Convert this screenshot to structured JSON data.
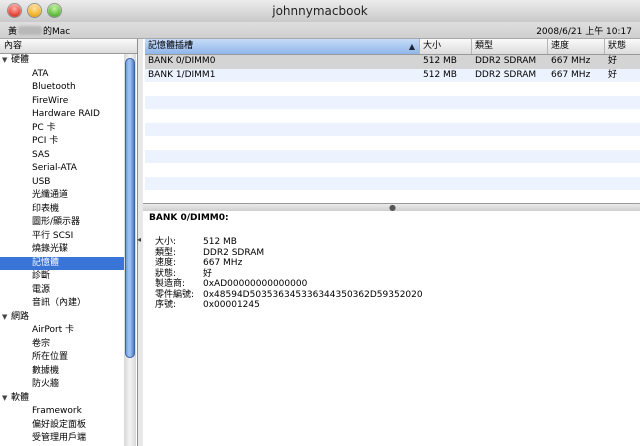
{
  "window": {
    "title": "johnnymacbook",
    "machine_name_prefix": "黃",
    "machine_name_suffix": "的Mac",
    "datetime": "2008/6/21 上午 10:17"
  },
  "sidebar": {
    "header": "內容",
    "tree": [
      {
        "type": "category",
        "label": "硬體",
        "expanded": true
      },
      {
        "type": "item",
        "label": "ATA"
      },
      {
        "type": "item",
        "label": "Bluetooth"
      },
      {
        "type": "item",
        "label": "FireWire"
      },
      {
        "type": "item",
        "label": "Hardware RAID"
      },
      {
        "type": "item",
        "label": "PC 卡"
      },
      {
        "type": "item",
        "label": "PCI 卡"
      },
      {
        "type": "item",
        "label": "SAS"
      },
      {
        "type": "item",
        "label": "Serial-ATA"
      },
      {
        "type": "item",
        "label": "USB"
      },
      {
        "type": "item",
        "label": "光纖通道"
      },
      {
        "type": "item",
        "label": "印表機"
      },
      {
        "type": "item",
        "label": "圖形/顯示器"
      },
      {
        "type": "item",
        "label": "平行 SCSI"
      },
      {
        "type": "item",
        "label": "燒錄光碟"
      },
      {
        "type": "item",
        "label": "記憶體",
        "selected": true
      },
      {
        "type": "item",
        "label": "診斷"
      },
      {
        "type": "item",
        "label": "電源"
      },
      {
        "type": "item",
        "label": "音訊（內建）"
      },
      {
        "type": "category",
        "label": "網路",
        "expanded": true
      },
      {
        "type": "item",
        "label": "AirPort 卡"
      },
      {
        "type": "item",
        "label": "卷宗"
      },
      {
        "type": "item",
        "label": "所在位置"
      },
      {
        "type": "item",
        "label": "數據機"
      },
      {
        "type": "item",
        "label": "防火牆"
      },
      {
        "type": "category",
        "label": "軟體",
        "expanded": true
      },
      {
        "type": "item",
        "label": "Framework"
      },
      {
        "type": "item",
        "label": "偏好設定面板"
      },
      {
        "type": "item",
        "label": "受管理用戶端"
      }
    ]
  },
  "table": {
    "columns": [
      "記憶體插槽",
      "大小",
      "類型",
      "速度",
      "狀態"
    ],
    "sort_indicator": "▲",
    "rows": [
      [
        "BANK 0/DIMM0",
        "512 MB",
        "DDR2 SDRAM",
        "667 MHz",
        "好"
      ],
      [
        "BANK 1/DIMM1",
        "512 MB",
        "DDR2 SDRAM",
        "667 MHz",
        "好"
      ]
    ],
    "selected_row": 0
  },
  "detail": {
    "title": "BANK 0/DIMM0:",
    "fields": [
      {
        "label": "大小:",
        "value": "512 MB"
      },
      {
        "label": "類型:",
        "value": "DDR2 SDRAM"
      },
      {
        "label": "速度:",
        "value": "667 MHz"
      },
      {
        "label": "狀態:",
        "value": "好"
      },
      {
        "label": "製造商:",
        "value": "0xAD00000000000000"
      },
      {
        "label": "零件編號:",
        "value": "0x48594D503536345336344350362D59352020"
      },
      {
        "label": "序號:",
        "value": "0x00001245"
      }
    ]
  },
  "icons": {
    "close": "close-icon",
    "minimize": "minimize-icon",
    "zoom": "zoom-icon",
    "expanded_triangle": "▼"
  },
  "colors": {
    "selection": "#3875d7",
    "stripe": "#edf3fe"
  }
}
